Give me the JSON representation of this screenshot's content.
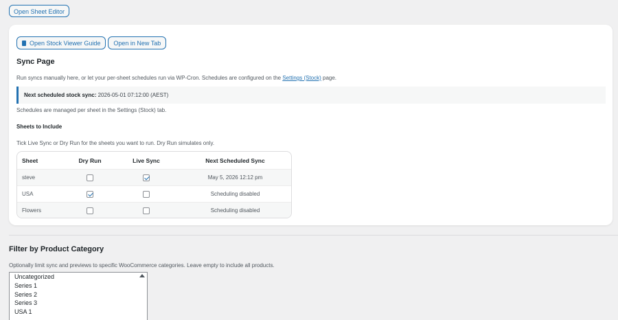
{
  "top": {
    "open_sheet_editor": "Open Sheet Editor"
  },
  "guide": {
    "open_guide": "Open Stock Viewer Guide",
    "open_new_tab": "Open in New Tab"
  },
  "sync": {
    "title": "Sync Page",
    "intro_before": "Run syncs manually here, or let your per-sheet schedules run via WP-Cron. Schedules are configured on the ",
    "intro_link": "Settings (Stock)",
    "intro_after": " page.",
    "notice_label": "Next scheduled stock sync:",
    "notice_value": " 2026-05-01 07:12:00 (AEST)",
    "managed_note": "Schedules are managed per sheet in the Settings (Stock) tab.",
    "sheets_heading": "Sheets to Include",
    "tick_note": "Tick Live Sync or Dry Run for the sheets you want to run. Dry Run simulates only."
  },
  "table": {
    "headers": [
      "Sheet",
      "Dry Run",
      "Live Sync",
      "Next Scheduled Sync"
    ],
    "rows": [
      {
        "sheet": "steve",
        "dry_run": false,
        "live_sync": true,
        "next": "May 5, 2026 12:12 pm"
      },
      {
        "sheet": "USA",
        "dry_run": true,
        "live_sync": false,
        "next": "Scheduling disabled"
      },
      {
        "sheet": "Flowers",
        "dry_run": false,
        "live_sync": false,
        "next": "Scheduling disabled"
      }
    ]
  },
  "filter": {
    "title": "Filter by Product Category",
    "note": "Optionally limit sync and previews to specific WooCommerce categories. Leave empty to include all products.",
    "categories": [
      "Uncategorized",
      "Series 1",
      "Series 2",
      "Series 3",
      "USA 1"
    ]
  },
  "colors": {
    "accent": "#2271b1",
    "background": "#f0f0f1",
    "card": "#ffffff"
  },
  "icons": {
    "guide_button": "document-icon",
    "list_scroll": "scroll-up-arrow-icon"
  }
}
